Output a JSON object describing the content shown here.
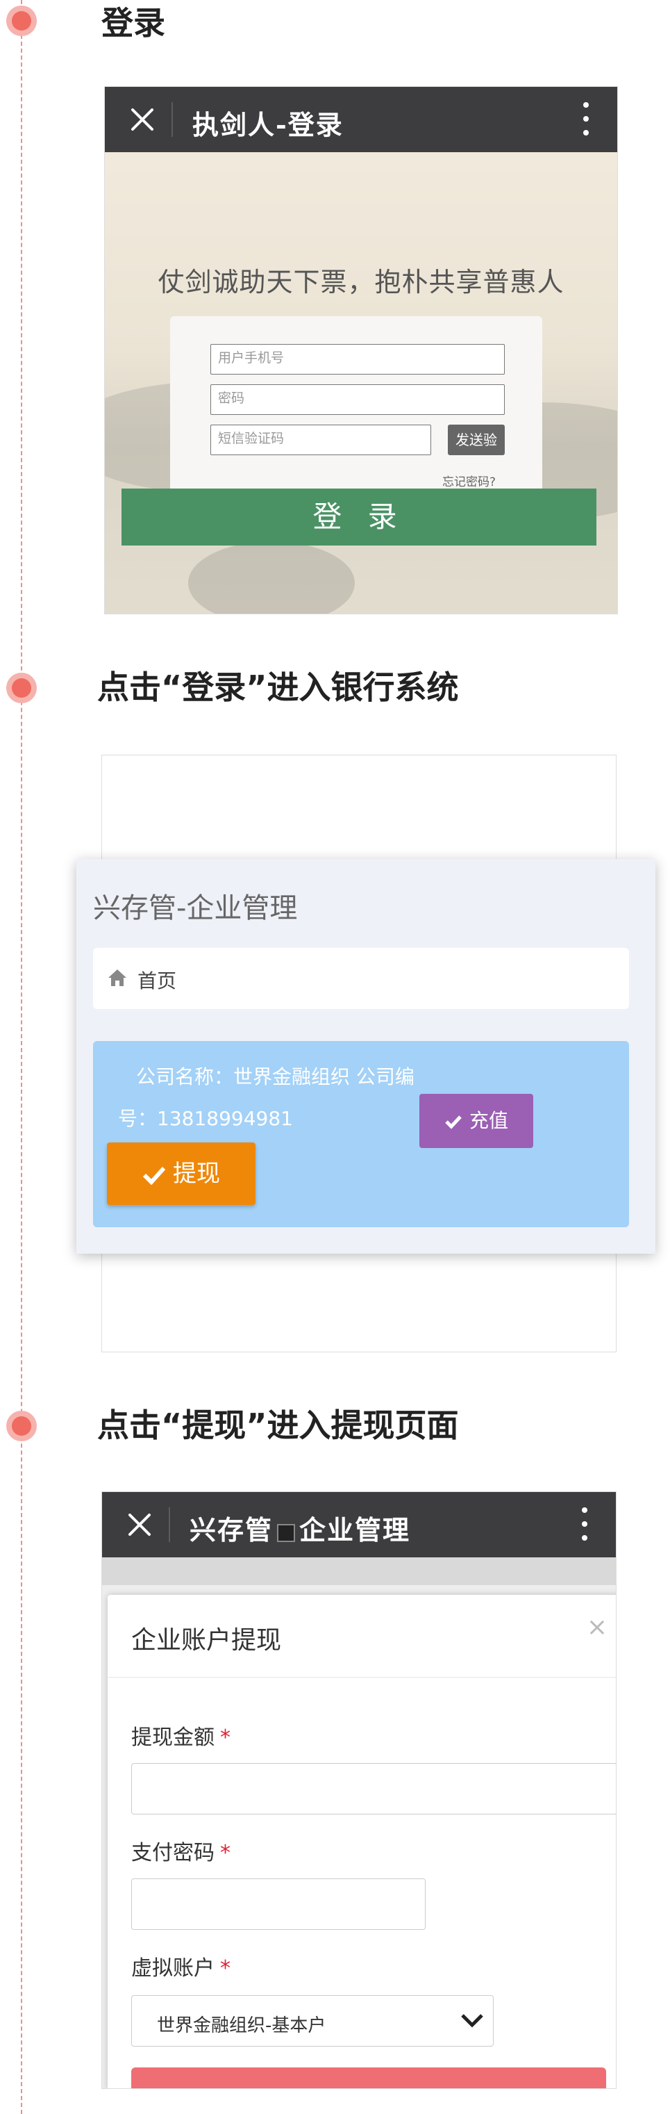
{
  "steps": [
    {
      "title": "登录"
    },
    {
      "title": "点击“登录”进入银行系统"
    },
    {
      "title": "点击“提现”进入提现页面"
    }
  ],
  "login": {
    "window_title": "执剑人-登录",
    "slogan": "仗剑诚助天下票，抱朴共享普惠人",
    "phone_placeholder": "用户手机号",
    "password_placeholder": "密码",
    "sms_placeholder": "短信验证码",
    "send_code_label": "发送验",
    "forgot_label": "忘记密码?",
    "login_button": "登 录"
  },
  "bank": {
    "title": "兴存管-企业管理",
    "breadcrumb": "首页",
    "company_line1": "公司名称：世界金融组织    公司编",
    "company_line2": "号：13818994981",
    "recharge_label": "充值",
    "withdraw_label": "提现"
  },
  "withdraw": {
    "window_title": "兴存管",
    "window_title_2": "企业管理",
    "modal_title": "企业账户提现",
    "amount_label": "提现金额",
    "password_label": "支付密码",
    "account_label": "虚拟账户",
    "required_mark": "*",
    "account_value": "世界金融组织-基本户",
    "close_symbol": "×"
  },
  "colors": {
    "accent_red": "#ef6a60",
    "login_green": "#4a9264",
    "recharge_purple": "#9b5fb4",
    "withdraw_orange": "#ef8809",
    "info_blue": "#a3d1f7"
  }
}
